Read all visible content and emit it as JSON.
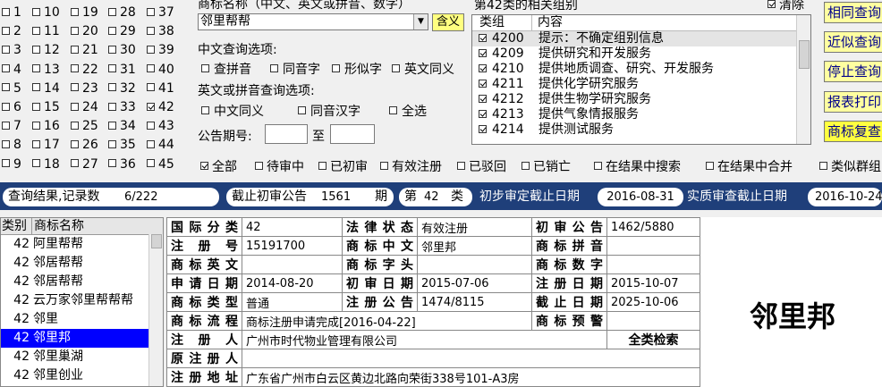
{
  "class_filter": {
    "columns": [
      [
        {
          "n": "1",
          "c": false
        },
        {
          "n": "2",
          "c": false
        },
        {
          "n": "3",
          "c": false
        },
        {
          "n": "4",
          "c": false
        },
        {
          "n": "5",
          "c": false
        },
        {
          "n": "6",
          "c": false
        },
        {
          "n": "7",
          "c": false
        },
        {
          "n": "8",
          "c": false
        },
        {
          "n": "9",
          "c": false
        }
      ],
      [
        {
          "n": "10",
          "c": false
        },
        {
          "n": "11",
          "c": false
        },
        {
          "n": "12",
          "c": false
        },
        {
          "n": "13",
          "c": false
        },
        {
          "n": "14",
          "c": false
        },
        {
          "n": "15",
          "c": false
        },
        {
          "n": "16",
          "c": false
        },
        {
          "n": "17",
          "c": false
        },
        {
          "n": "18",
          "c": false
        }
      ],
      [
        {
          "n": "19",
          "c": false
        },
        {
          "n": "20",
          "c": false
        },
        {
          "n": "21",
          "c": false
        },
        {
          "n": "22",
          "c": false
        },
        {
          "n": "23",
          "c": false
        },
        {
          "n": "24",
          "c": false
        },
        {
          "n": "25",
          "c": false
        },
        {
          "n": "26",
          "c": false
        },
        {
          "n": "27",
          "c": false
        }
      ],
      [
        {
          "n": "28",
          "c": false
        },
        {
          "n": "29",
          "c": false
        },
        {
          "n": "30",
          "c": false
        },
        {
          "n": "31",
          "c": false
        },
        {
          "n": "32",
          "c": false
        },
        {
          "n": "33",
          "c": false
        },
        {
          "n": "34",
          "c": false
        },
        {
          "n": "35",
          "c": false
        },
        {
          "n": "36",
          "c": false
        }
      ],
      [
        {
          "n": "37",
          "c": false
        },
        {
          "n": "38",
          "c": false
        },
        {
          "n": "39",
          "c": false
        },
        {
          "n": "40",
          "c": false
        },
        {
          "n": "41",
          "c": false
        },
        {
          "n": "42",
          "c": true
        },
        {
          "n": "43",
          "c": false
        },
        {
          "n": "44",
          "c": false
        },
        {
          "n": "45",
          "c": false
        }
      ]
    ]
  },
  "search": {
    "label": "商标名称（中文、英文或拼音、数字）",
    "value": "邻里帮帮",
    "include_btn": "含义",
    "cn_options_label": "中文查询选项:",
    "cn_options": [
      "查拼音",
      "同音字",
      "形似字",
      "英文同义"
    ],
    "en_options_label": "英文或拼音查询选项:",
    "en_options": [
      "中文同义",
      "同音汉字",
      "全选"
    ],
    "period_label": "公告期号:",
    "period_to": "至"
  },
  "group_list": {
    "title": "第42类的相关组别",
    "clear_label": "清除",
    "col_group": "类组",
    "col_content": "内容",
    "rows": [
      {
        "code": "4200",
        "desc": "提示：不确定组别信息"
      },
      {
        "code": "4209",
        "desc": "提供研究和开发服务"
      },
      {
        "code": "4210",
        "desc": "提供地质调查、研究、开发服务"
      },
      {
        "code": "4211",
        "desc": "提供化学研究服务"
      },
      {
        "code": "4212",
        "desc": "提供生物学研究服务"
      },
      {
        "code": "4213",
        "desc": "提供气象情报服务"
      },
      {
        "code": "4214",
        "desc": "提供测试服务"
      }
    ]
  },
  "buttons": [
    {
      "label": "相同查询",
      "bg": "#ffffa0"
    },
    {
      "label": "近似查询",
      "bg": "#ffffa0"
    },
    {
      "label": "停止查询",
      "bg": "#ffffa0"
    },
    {
      "label": "报表打印",
      "bg": "#ffffa0"
    },
    {
      "label": "商标复查",
      "bg": "#ffff40"
    }
  ],
  "filters": [
    {
      "label": "全部",
      "c": true
    },
    {
      "label": "待审中",
      "c": false
    },
    {
      "label": "已初审",
      "c": false
    },
    {
      "label": "有效注册",
      "c": false
    },
    {
      "label": "已驳回",
      "c": false
    },
    {
      "label": "已销亡",
      "c": false
    },
    {
      "label": "在结果中搜索",
      "c": false
    },
    {
      "label": "在结果中合并",
      "c": false
    },
    {
      "label": "类似群组",
      "c": false
    }
  ],
  "status": {
    "result_label": "查询结果,记录数",
    "result_count": "6/222",
    "cutoff_label": "截止初审公告",
    "cutoff_value": "1561",
    "cutoff_unit": "期",
    "class_prefix": "第",
    "class_value": "42",
    "class_suffix": "类",
    "prelim_label": "初步审定截止日期",
    "prelim_date": "2016-08-31",
    "substantive_label": "实质审查截止日期",
    "substantive_date": "2016-10-24"
  },
  "results": {
    "col_class": "类别",
    "col_name": "商标名称",
    "rows": [
      {
        "cls": "42",
        "name": "阿里帮帮",
        "sel": false
      },
      {
        "cls": "42",
        "name": "邻居帮帮",
        "sel": false
      },
      {
        "cls": "42",
        "name": "邻居帮帮",
        "sel": false
      },
      {
        "cls": "42",
        "name": "云万家邻里帮帮帮",
        "sel": false
      },
      {
        "cls": "42",
        "name": "邻里",
        "sel": false
      },
      {
        "cls": "42",
        "name": "邻里邦",
        "sel": true
      },
      {
        "cls": "42",
        "name": "邻里巢湖",
        "sel": false
      },
      {
        "cls": "42",
        "name": "邻里创业",
        "sel": false
      }
    ]
  },
  "detail": {
    "intl_class_k": "国际分类",
    "intl_class_v": "42",
    "legal_status_k": "法律状态",
    "legal_status_v": "有效注册",
    "prelim_pub_k": "初审公告",
    "prelim_pub_v": "1462/5880",
    "reg_no_k": "注 册 号",
    "reg_no_v": "15191700",
    "cn_name_k": "商标中文",
    "cn_name_v": "邻里邦",
    "pinyin_k": "商标拼音",
    "pinyin_v": "",
    "en_name_k": "商标英文",
    "en_name_v": "",
    "initials_k": "商标字头",
    "initials_v": "",
    "digits_k": "商标数字",
    "digits_v": "",
    "apply_date_k": "申请日期",
    "apply_date_v": "2014-08-20",
    "prelim_date_k": "初审日期",
    "prelim_date_v": "2015-07-06",
    "reg_date_k": "注册日期",
    "reg_date_v": "2015-10-07",
    "type_k": "商标类型",
    "type_v": "普通",
    "reg_pub_k": "注册公告",
    "reg_pub_v": "1474/8115",
    "expiry_k": "截止日期",
    "expiry_v": "2025-10-06",
    "flow_k": "商标流程",
    "flow_v": "商标注册申请完成[2016-04-22]",
    "warn_k": "商标预警",
    "warn_v": "",
    "registrant_k": "注 册 人",
    "registrant_v": "广州市时代物业管理有限公司",
    "all_class_search": "全类检索",
    "orig_registrant_k": "原注册人",
    "orig_registrant_v": "",
    "address_k": "注册地址",
    "address_v": "广东省广州市白云区黄边北路向荣街338号101-A3房"
  },
  "preview": {
    "name": "邻里邦"
  }
}
